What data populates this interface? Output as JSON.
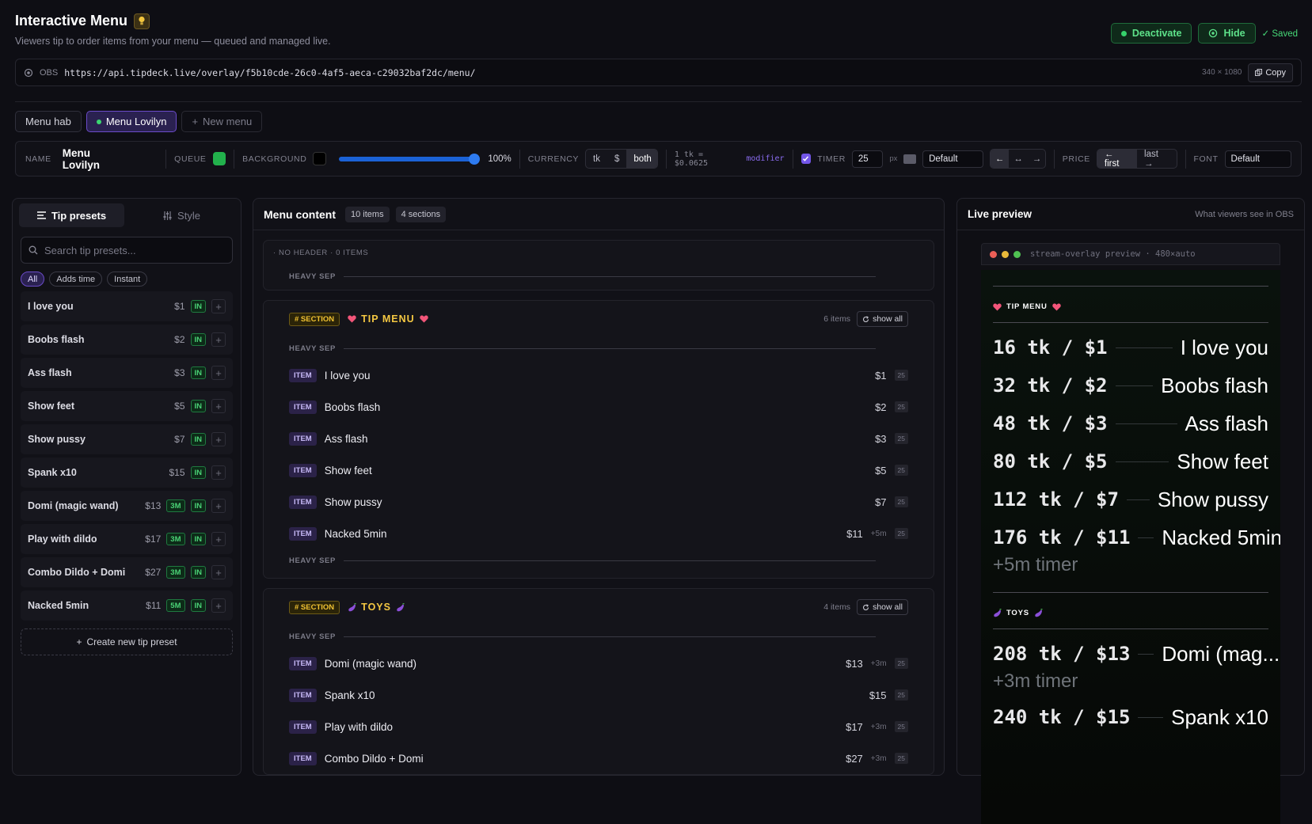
{
  "header": {
    "title": "Interactive Menu",
    "subtitle": "Viewers tip to order items from your menu — queued and managed live.",
    "deactivate_label": "Deactivate",
    "hide_label": "Hide",
    "saved_label": "✓ Saved"
  },
  "obs": {
    "label": "OBS",
    "url": "https://api.tipdeck.live/overlay/f5b10cde-26c0-4af5-aeca-c29032baf2dc/menu/",
    "dimensions": "340 × 1080",
    "copy_label": "Copy"
  },
  "tabs": [
    {
      "label": "Menu hab"
    },
    {
      "label": "Menu Lovilyn",
      "active": true
    },
    {
      "label": "New menu"
    }
  ],
  "settings": {
    "name_label": "NAME",
    "name_value": "Menu Lovilyn",
    "queue_label": "QUEUE",
    "background_label": "BACKGROUND",
    "opacity": "100%",
    "currency_label": "CURRENCY",
    "currency_options": [
      "tk",
      "$",
      "both"
    ],
    "currency_selected": "both",
    "rate": "1 tk = $0.0625",
    "modifier": "modifier",
    "timer_label": "TIMER",
    "timer_value": "25",
    "timer_unit": "px",
    "timer_font": "Default",
    "align_options": [
      "←",
      "↔",
      "→"
    ],
    "price_label": "PRICE",
    "price_options": [
      "← first",
      "last →"
    ],
    "price_selected": "← first",
    "font_label": "FONT",
    "font_value": "Default",
    "colors": {
      "queue": "#22b14c",
      "background": "#000000",
      "accent": "#7356e8"
    }
  },
  "left": {
    "tab_presets": "Tip presets",
    "tab_style": "Style",
    "search_placeholder": "Search tip presets...",
    "filters": [
      "All",
      "Adds time",
      "Instant"
    ],
    "presets": [
      {
        "name": "I love you",
        "price": "$1",
        "badges": [
          "IN"
        ]
      },
      {
        "name": "Boobs flash",
        "price": "$2",
        "badges": [
          "IN"
        ]
      },
      {
        "name": "Ass flash",
        "price": "$3",
        "badges": [
          "IN"
        ]
      },
      {
        "name": "Show feet",
        "price": "$5",
        "badges": [
          "IN"
        ]
      },
      {
        "name": "Show pussy",
        "price": "$7",
        "badges": [
          "IN"
        ]
      },
      {
        "name": "Spank x10",
        "price": "$15",
        "badges": [
          "IN"
        ]
      },
      {
        "name": "Domi (magic wand)",
        "price": "$13",
        "badges": [
          "3M",
          "IN"
        ]
      },
      {
        "name": "Play with dildo",
        "price": "$17",
        "badges": [
          "3M",
          "IN"
        ]
      },
      {
        "name": "Combo Dildo + Domi",
        "price": "$27",
        "badges": [
          "3M",
          "IN"
        ]
      },
      {
        "name": "Nacked 5min",
        "price": "$11",
        "badges": [
          "5M",
          "IN"
        ]
      }
    ],
    "create_label": "Create new tip preset"
  },
  "middle": {
    "title": "Menu content",
    "items_count": "10 items",
    "sections_count": "4 sections",
    "nohead_label": "· NO HEADER · 0 ITEMS",
    "heavy_sep": "HEAVY SEP",
    "section_tag": "# SECTION",
    "item_tag": "ITEM",
    "show_all": "show all",
    "sections": [
      {
        "name": "TIP MENU",
        "count": "6 items",
        "items": [
          {
            "name": "I love you",
            "price": "$1",
            "mod": "",
            "size": "25"
          },
          {
            "name": "Boobs flash",
            "price": "$2",
            "mod": "",
            "size": "25"
          },
          {
            "name": "Ass flash",
            "price": "$3",
            "mod": "",
            "size": "25"
          },
          {
            "name": "Show feet",
            "price": "$5",
            "mod": "",
            "size": "25"
          },
          {
            "name": "Show pussy",
            "price": "$7",
            "mod": "",
            "size": "25"
          },
          {
            "name": "Nacked 5min",
            "price": "$11",
            "mod": "+5m",
            "size": "25"
          }
        ]
      },
      {
        "name": "TOYS",
        "count": "4 items",
        "items": [
          {
            "name": "Domi (magic wand)",
            "price": "$13",
            "mod": "+3m",
            "size": "25"
          },
          {
            "name": "Spank x10",
            "price": "$15",
            "mod": "",
            "size": "25"
          },
          {
            "name": "Play with dildo",
            "price": "$17",
            "mod": "+3m",
            "size": "25"
          },
          {
            "name": "Combo Dildo + Domi",
            "price": "$27",
            "mod": "+3m",
            "size": "25"
          }
        ]
      }
    ]
  },
  "preview": {
    "title": "Live preview",
    "subtitle": "What viewers see in OBS",
    "window_caption": "stream-overlay preview · 480×auto",
    "sections": [
      {
        "name": "TIP MENU",
        "rows": [
          {
            "price": "16 tk / $1",
            "name": "I love you",
            "timer": ""
          },
          {
            "price": "32 tk / $2",
            "name": "Boobs flash",
            "timer": ""
          },
          {
            "price": "48 tk / $3",
            "name": "Ass flash",
            "timer": ""
          },
          {
            "price": "80 tk / $5",
            "name": "Show feet",
            "timer": ""
          },
          {
            "price": "112 tk / $7",
            "name": "Show pussy",
            "timer": ""
          },
          {
            "price": "176 tk / $11",
            "name": "Nacked 5min",
            "timer": "+5m timer"
          }
        ]
      },
      {
        "name": "TOYS",
        "rows": [
          {
            "price": "208 tk / $13",
            "name": "Domi (mag...",
            "timer": "+3m timer"
          },
          {
            "price": "240 tk / $15",
            "name": "Spank x10",
            "timer": ""
          }
        ]
      }
    ]
  }
}
